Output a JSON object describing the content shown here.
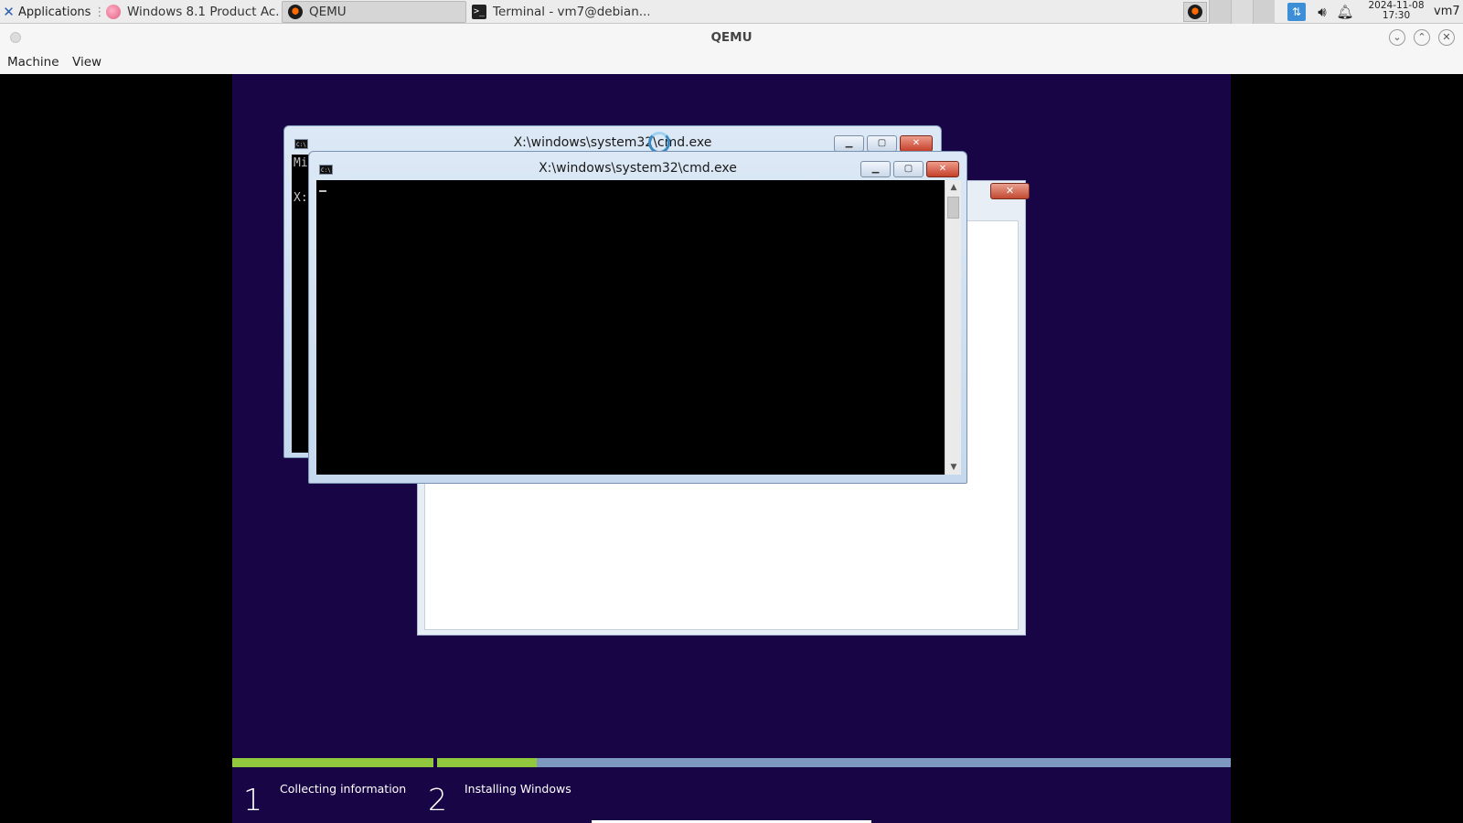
{
  "panel": {
    "applications_label": "Applications",
    "tasks": [
      {
        "label": "Windows 8.1 Product Ac..."
      },
      {
        "label": "QEMU"
      },
      {
        "label": "Terminal - vm7@debian..."
      }
    ],
    "clock_date": "2024-11-08",
    "clock_time": "17:30",
    "user": "vm7"
  },
  "qemu": {
    "title": "QEMU",
    "menu": {
      "machine": "Machine",
      "view": "View"
    }
  },
  "guest": {
    "cmd_back": {
      "title": "X:\\windows\\system32\\cmd.exe",
      "lines": [
        "Mi",
        "X:"
      ]
    },
    "cmd_front": {
      "title": "X:\\windows\\system32\\cmd.exe"
    },
    "steps": [
      {
        "number": "1",
        "label": "Collecting information",
        "progress": 1.0
      },
      {
        "number": "2",
        "label": "Installing Windows",
        "progress": 0.125
      }
    ],
    "colors": {
      "background": "#180545",
      "progress_done": "#92c83e",
      "progress_remaining": "#7d99bf"
    }
  }
}
